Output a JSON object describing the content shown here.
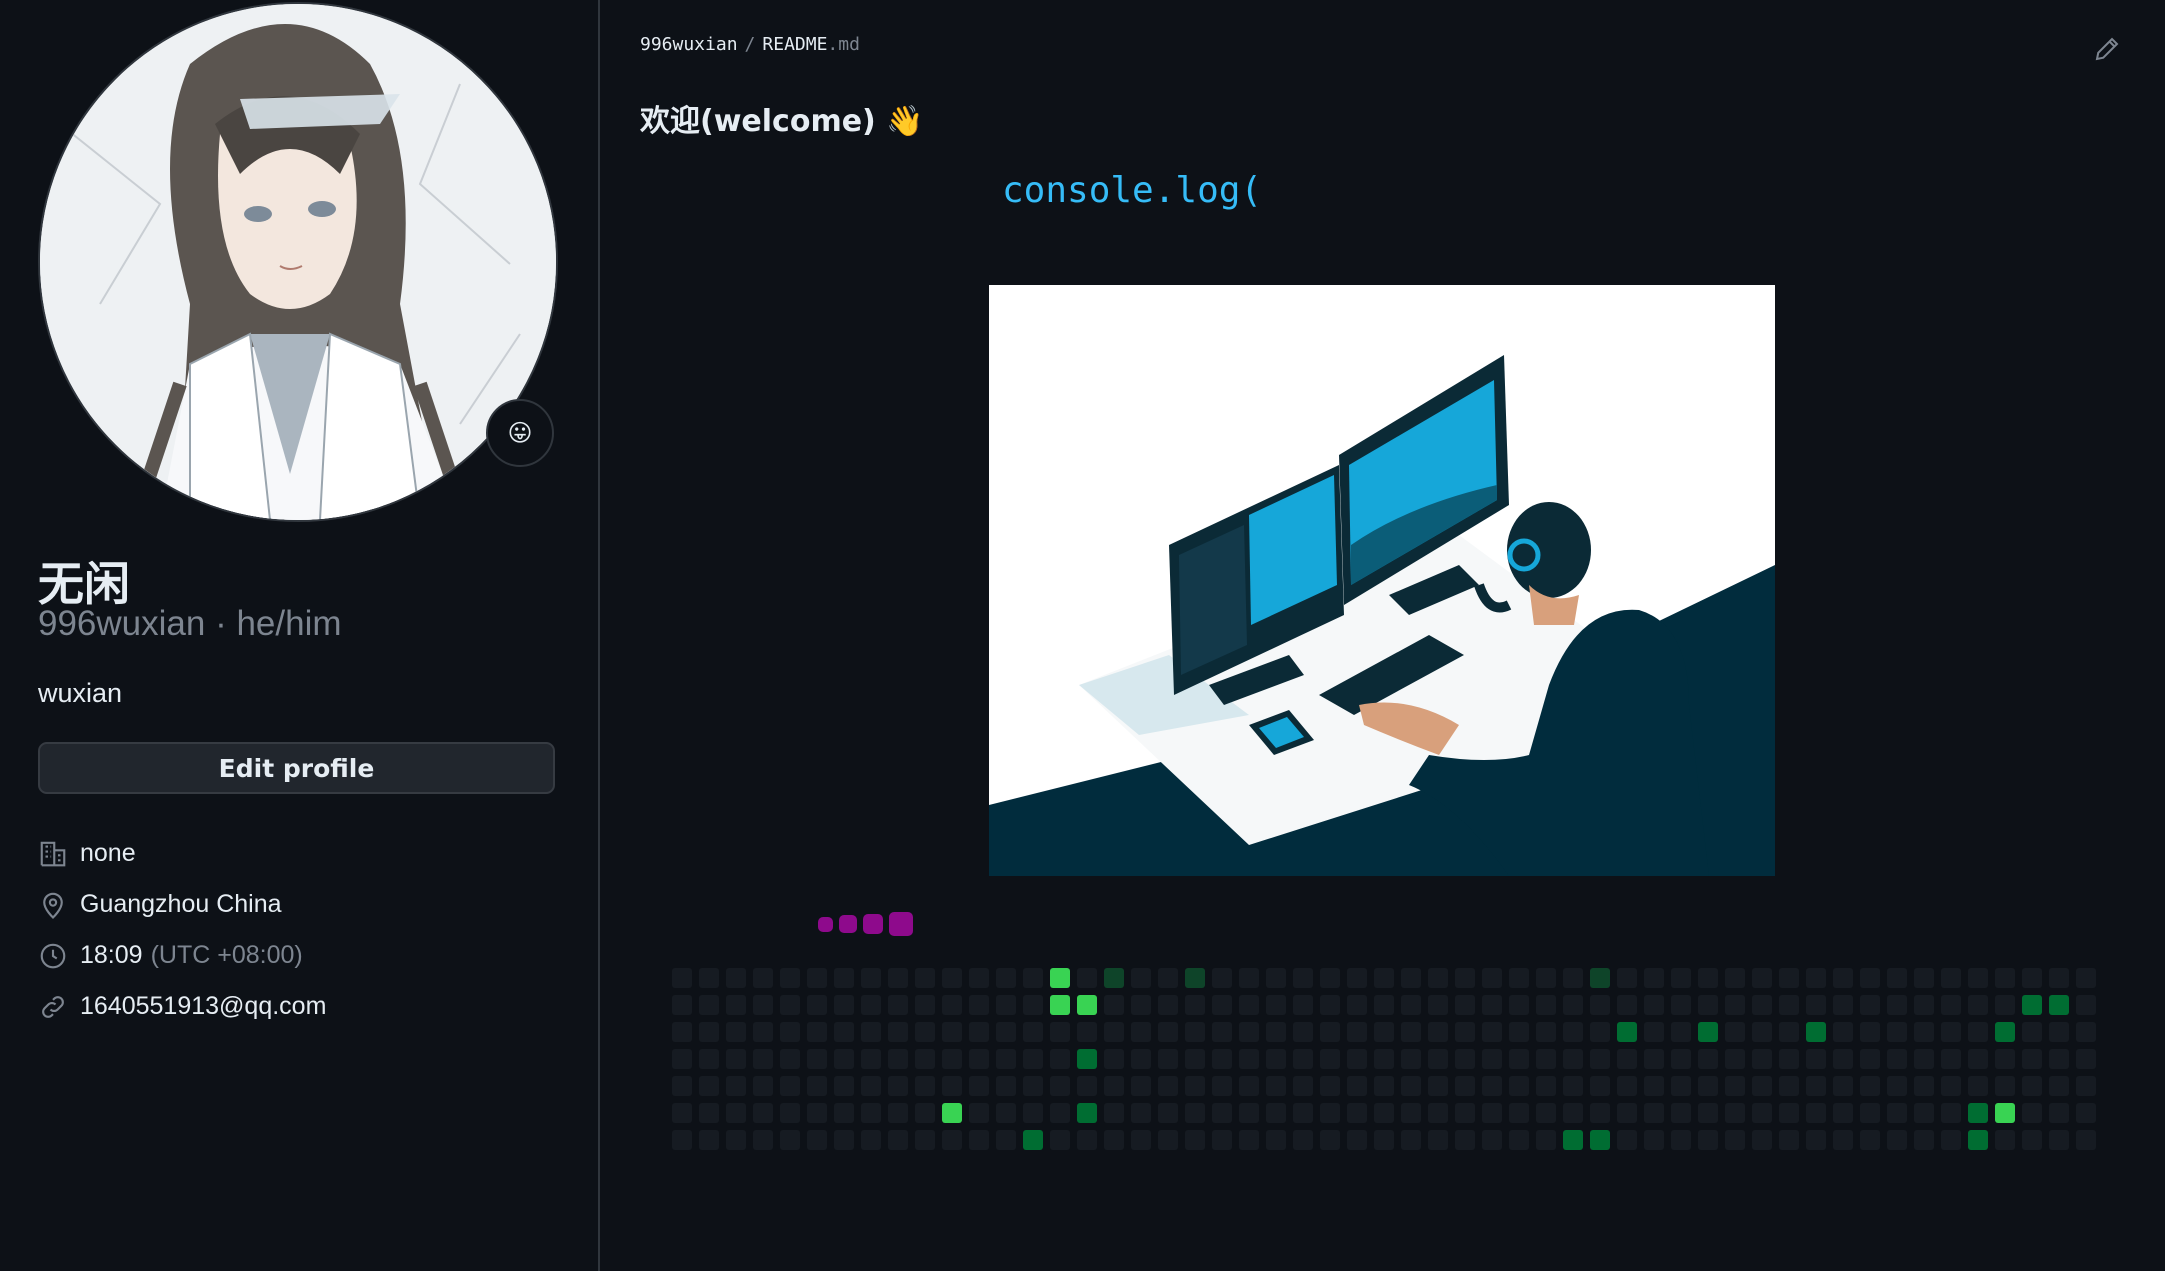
{
  "profile": {
    "name": "无闲",
    "login_line": "996wuxian · he/him",
    "bio": "wuxian",
    "edit_label": "Edit profile",
    "status_emoji": "😛",
    "details": [
      {
        "icon": "organization-icon",
        "text": "none",
        "muted": ""
      },
      {
        "icon": "location-icon",
        "text": "Guangzhou China",
        "muted": ""
      },
      {
        "icon": "clock-icon",
        "text": "18:09",
        "muted": "(UTC +08:00)"
      },
      {
        "icon": "link-icon",
        "text": "1640551913@qq.com",
        "muted": ""
      }
    ]
  },
  "readme": {
    "owner": "996wuxian",
    "separator": "/",
    "file_name": "README",
    "file_ext": ".md",
    "welcome": "欢迎(welcome) 👋",
    "typing_text": "console.log("
  },
  "colors": {
    "background": "#0d1117",
    "accent_blue": "#36bcf7",
    "snake_purple": "#8e0a8c",
    "contrib_empty": "#161b22",
    "contrib_l1": "#0e4429",
    "contrib_l2": "#006d32",
    "contrib_l3": "#26a641",
    "contrib_l4": "#39d353"
  },
  "contribution_grid": {
    "columns": 53,
    "rows": 7,
    "active_cells": [
      {
        "col": 14,
        "row": 0,
        "level": 4
      },
      {
        "col": 16,
        "row": 0,
        "level": 1
      },
      {
        "col": 19,
        "row": 0,
        "level": 1
      },
      {
        "col": 34,
        "row": 0,
        "level": 1
      },
      {
        "col": 14,
        "row": 1,
        "level": 4
      },
      {
        "col": 15,
        "row": 1,
        "level": 4
      },
      {
        "col": 50,
        "row": 1,
        "level": 2
      },
      {
        "col": 51,
        "row": 1,
        "level": 2
      },
      {
        "col": 35,
        "row": 2,
        "level": 2
      },
      {
        "col": 38,
        "row": 2,
        "level": 2
      },
      {
        "col": 42,
        "row": 2,
        "level": 2
      },
      {
        "col": 49,
        "row": 2,
        "level": 2
      },
      {
        "col": 15,
        "row": 3,
        "level": 2
      },
      {
        "col": 10,
        "row": 5,
        "level": 4
      },
      {
        "col": 15,
        "row": 5,
        "level": 2
      },
      {
        "col": 48,
        "row": 5,
        "level": 2
      },
      {
        "col": 49,
        "row": 5,
        "level": 4
      },
      {
        "col": 13,
        "row": 6,
        "level": 2
      },
      {
        "col": 33,
        "row": 6,
        "level": 2
      },
      {
        "col": 34,
        "row": 6,
        "level": 2
      },
      {
        "col": 48,
        "row": 6,
        "level": 2
      }
    ]
  }
}
